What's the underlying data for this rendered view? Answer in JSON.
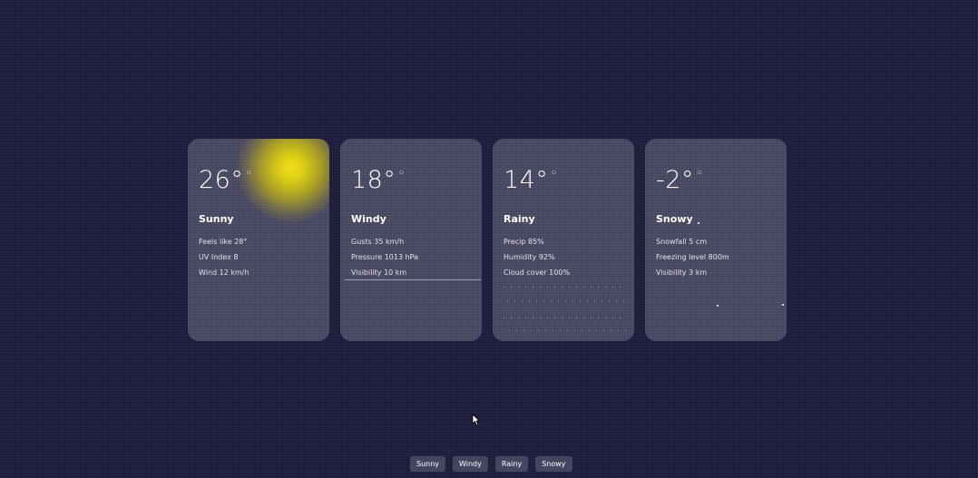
{
  "cards": [
    {
      "temp": "26°",
      "unit_mark": "○",
      "condition": "Sunny",
      "details": [
        "Feels like 28°",
        "UV Index 8",
        "Wind 12 km/h"
      ]
    },
    {
      "temp": "18°",
      "unit_mark": "○",
      "condition": "Windy",
      "details": [
        "Gusts 35 km/h",
        "Pressure 1013 hPa",
        "Visibility 10 km"
      ]
    },
    {
      "temp": "14°",
      "unit_mark": "○",
      "condition": "Rainy",
      "details": [
        "Precip 85%",
        "Humidity 92%",
        "Cloud cover 100%"
      ]
    },
    {
      "temp": "-2°",
      "unit_mark": "○",
      "condition": "Snowy",
      "details": [
        "Snowfall 5 cm",
        "Freezing level 800m",
        "Visibility 3 km"
      ]
    }
  ],
  "tabs": [
    "Sunny",
    "Windy",
    "Rainy",
    "Snowy"
  ],
  "colors": {
    "background": "#1b1a3a",
    "card": "#45445e",
    "sun": "#f2e21a",
    "tab": "#46455f"
  }
}
